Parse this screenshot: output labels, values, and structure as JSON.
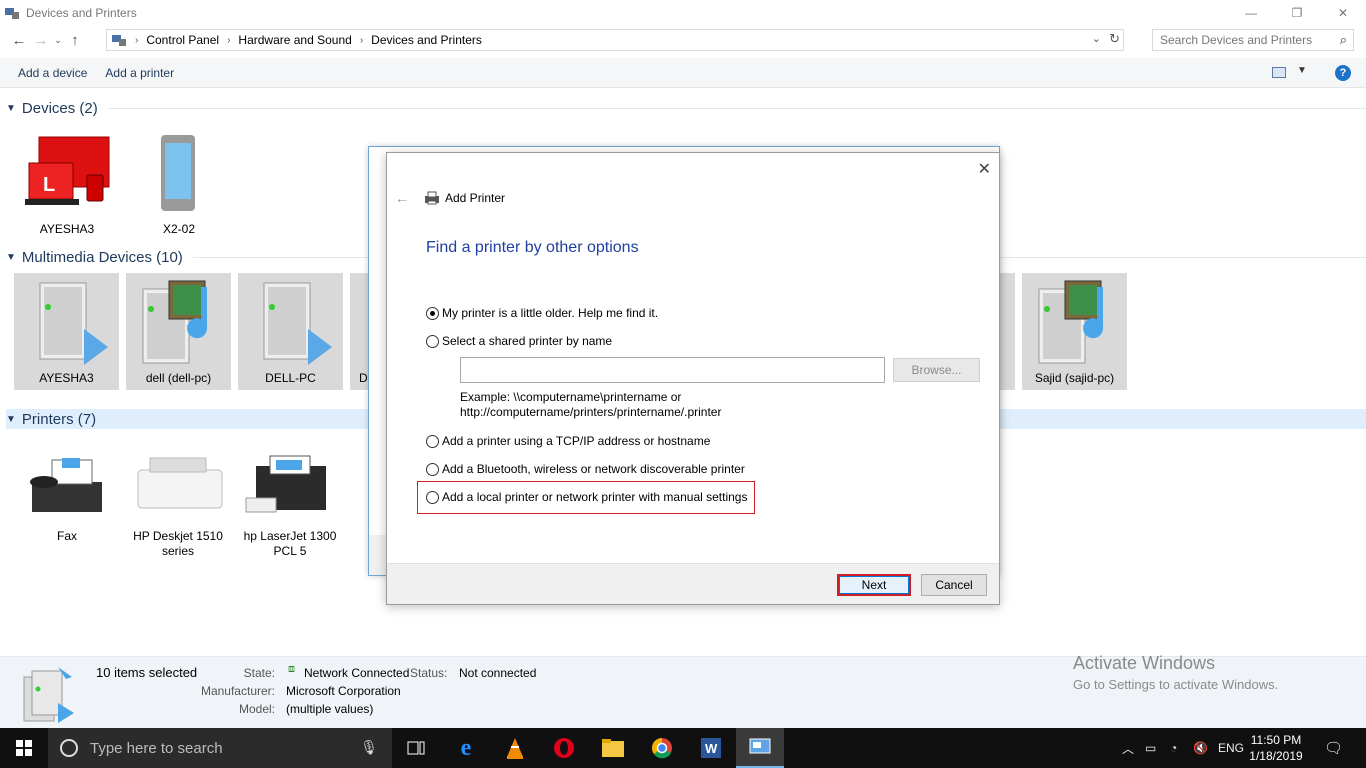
{
  "window": {
    "title": "Devices and Printers",
    "controls": [
      "—",
      "❐",
      "✕"
    ]
  },
  "nav": {
    "breadcrumbs": [
      "Control Panel",
      "Hardware and Sound",
      "Devices and Printers"
    ],
    "search_placeholder": "Search Devices and Printers"
  },
  "toolbar": {
    "add_device": "Add a device",
    "add_printer": "Add a printer",
    "help": "?"
  },
  "groups": {
    "devices": {
      "title": "Devices (2)",
      "items": [
        "AYESHA3",
        "X2-02"
      ]
    },
    "multimedia": {
      "title": "Multimedia Devices (10)",
      "items": [
        "AYESHA3",
        "dell (dell-pc)",
        "DELL-PC",
        "D",
        "Sajid (sajid-pc)"
      ]
    },
    "printers": {
      "title": "Printers (7)",
      "items": [
        "Fax",
        "HP Deskjet 1510 series",
        "hp LaserJet 1300 PCL 5"
      ]
    }
  },
  "details": {
    "selected": "10 items selected",
    "state_label": "State:",
    "state_value": "Network Connected",
    "status_label": "Status:",
    "status_value": "Not connected",
    "manufacturer_label": "Manufacturer:",
    "manufacturer_value": "Microsoft Corporation",
    "model_label": "Model:",
    "model_value": "(multiple values)"
  },
  "watermark": {
    "title": "Activate Windows",
    "subtitle": "Go to Settings to activate Windows."
  },
  "dialog": {
    "title": "Add Printer",
    "heading": "Find a printer by other options",
    "options": [
      {
        "label": "My printer is a little older. Help me find it.",
        "selected": true
      },
      {
        "label": "Select a shared printer by name",
        "selected": false
      },
      {
        "label": "Add a printer using a TCP/IP address or hostname",
        "selected": false
      },
      {
        "label": "Add a Bluetooth, wireless or network discoverable printer",
        "selected": false
      },
      {
        "label": "Add a local printer or network printer with manual settings",
        "selected": false
      }
    ],
    "shared_printer_value": "",
    "browse": "Browse...",
    "example_line1": "Example: \\\\computername\\printername or",
    "example_line2": "http://computername/printers/printername/.printer",
    "next": "Next",
    "cancel": "Cancel"
  },
  "taskbar": {
    "search_placeholder": "Type here to search",
    "language": "ENG",
    "time": "11:50 PM",
    "date": "1/18/2019"
  },
  "colors": {
    "accent": "#1e395b",
    "dialog_heading": "#1f3fa1",
    "highlight": "#d21f1f",
    "taskbar": "#101010"
  }
}
